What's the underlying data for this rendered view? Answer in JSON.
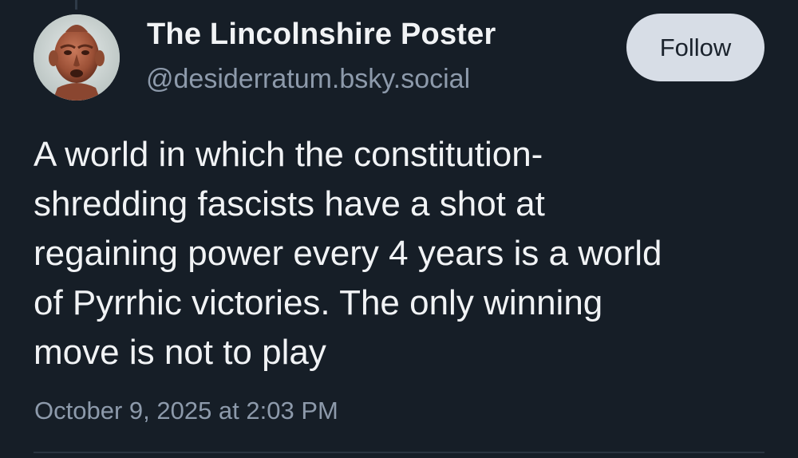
{
  "post": {
    "author": {
      "display_name": "The Lincolnshire Poster",
      "handle": "@desiderratum.bsky.social",
      "avatar_icon": "terracotta-figure-avatar"
    },
    "follow_label": "Follow",
    "text": "A world in which the constitution-\nshredding fascists have a shot at\nregaining power every 4 years is a world\nof Pyrrhic victories. The only winning\nmove is not to play",
    "timestamp": "October 9, 2025 at 2:03 PM"
  },
  "colors": {
    "background": "#161e27",
    "text_primary": "#f1f3f5",
    "text_secondary": "#8d9aab",
    "button_bg": "#d7dde6",
    "button_text": "#1b232d"
  }
}
